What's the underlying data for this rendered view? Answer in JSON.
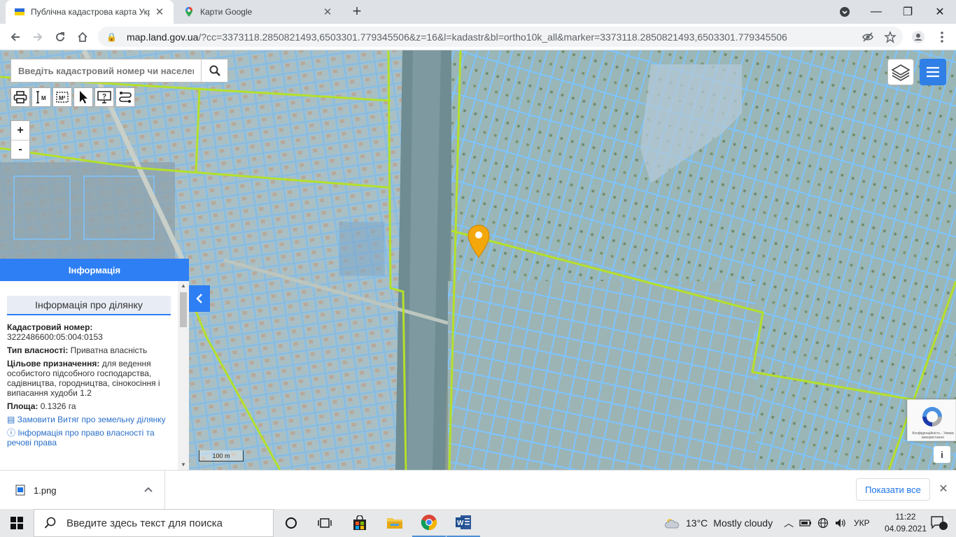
{
  "browser": {
    "tabs": [
      {
        "title": "Публічна кадастрова карта Укр",
        "icon": "ukraine-flag-icon"
      },
      {
        "title": "Карти Google",
        "icon": "google-maps-icon"
      }
    ],
    "url_host": "map.land.gov.ua",
    "url_rest": "/?cc=3373118.2850821493,6503301.779345506&z=16&l=kadastr&bl=ortho10k_all&marker=3373118.2850821493,6503301.779345506"
  },
  "map": {
    "search_placeholder": "Введіть кадастровий номер чи населений",
    "scale_label": "100 m",
    "recaptcha_text": "Конфіденційність - Умови використання",
    "info_button": "i",
    "zoom_in": "+",
    "zoom_out": "-"
  },
  "info_panel": {
    "header": "Інформація",
    "title": "Інформація про ділянку",
    "cadastral_label": "Кадастровий номер:",
    "cadastral_value": "3222486600:05:004:0153",
    "ownership_label": "Тип власності:",
    "ownership_value": "Приватна власність",
    "purpose_label": "Цільове призначення:",
    "purpose_value": "для ведення особистого підсобного господарства, садівництва, городництва, сінокосіння і випасання худоби 1.2",
    "area_label": "Площа:",
    "area_value": "0.1326 га",
    "link_extract": "Замовити Витяг про земельну ділянку",
    "link_rights": "Інформація про право власності та речові права"
  },
  "downloads": {
    "file_name": "1.png",
    "show_all": "Показати все"
  },
  "taskbar": {
    "search_placeholder": "Введите здесь текст для поиска",
    "weather_temp": "13°C",
    "weather_desc": "Mostly cloudy",
    "language": "УКР",
    "time": "11:22",
    "date": "04.09.2021",
    "notification_count": "4"
  },
  "colors": {
    "accent": "#2e7ff4",
    "parcel_outline": "#7cc4ff",
    "boundary_line": "#b5e02b",
    "marker": "#f4a70a"
  }
}
